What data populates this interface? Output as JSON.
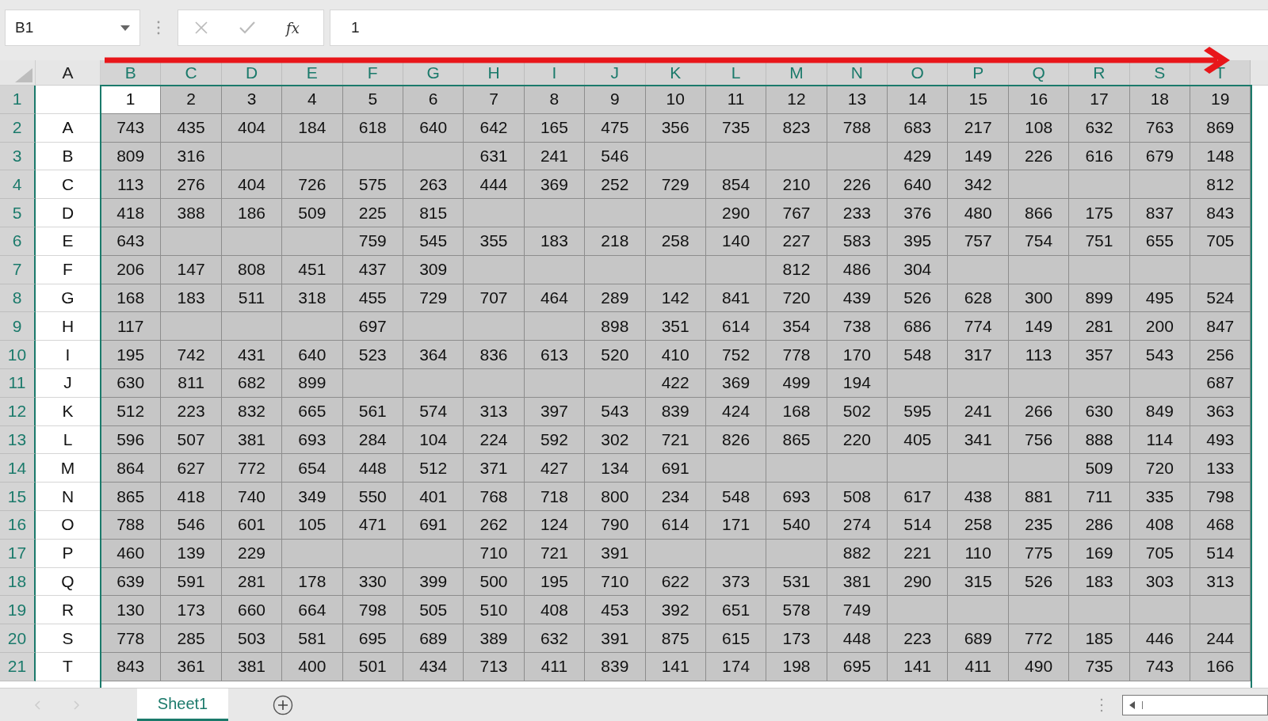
{
  "name_box": {
    "value": "B1"
  },
  "formula_bar": {
    "function_label": "fx",
    "value": "1"
  },
  "columns": [
    {
      "label": "A",
      "selected": false
    },
    {
      "label": "B",
      "selected": true
    },
    {
      "label": "C",
      "selected": true
    },
    {
      "label": "D",
      "selected": true
    },
    {
      "label": "E",
      "selected": true
    },
    {
      "label": "F",
      "selected": true
    },
    {
      "label": "G",
      "selected": true
    },
    {
      "label": "H",
      "selected": true
    },
    {
      "label": "I",
      "selected": true
    },
    {
      "label": "J",
      "selected": true
    },
    {
      "label": "K",
      "selected": true
    },
    {
      "label": "L",
      "selected": true
    },
    {
      "label": "M",
      "selected": true
    },
    {
      "label": "N",
      "selected": true
    },
    {
      "label": "O",
      "selected": true
    },
    {
      "label": "P",
      "selected": true
    },
    {
      "label": "Q",
      "selected": true
    },
    {
      "label": "R",
      "selected": true
    },
    {
      "label": "S",
      "selected": true
    },
    {
      "label": "T",
      "selected": true
    }
  ],
  "rows": [
    {
      "header": "1",
      "selected": true,
      "cells": [
        null,
        {
          "value": "1",
          "active": true
        },
        "2",
        "3",
        "4",
        "5",
        "6",
        "7",
        "8",
        "9",
        "10",
        "11",
        "12",
        "13",
        "14",
        "15",
        "16",
        "17",
        "18",
        "19"
      ]
    },
    {
      "header": "2",
      "selected": true,
      "cells": [
        "A",
        "743",
        "435",
        "404",
        "184",
        "618",
        "640",
        "642",
        "165",
        "475",
        "356",
        "735",
        "823",
        "788",
        "683",
        "217",
        "108",
        "632",
        "763",
        "869"
      ]
    },
    {
      "header": "3",
      "selected": true,
      "cells": [
        "B",
        "809",
        "316",
        null,
        null,
        null,
        null,
        "631",
        "241",
        "546",
        null,
        null,
        null,
        null,
        "429",
        "149",
        "226",
        "616",
        "679",
        "148"
      ]
    },
    {
      "header": "4",
      "selected": true,
      "cells": [
        "C",
        "113",
        "276",
        "404",
        "726",
        "575",
        "263",
        "444",
        "369",
        "252",
        "729",
        "854",
        "210",
        "226",
        "640",
        "342",
        null,
        null,
        null,
        "812"
      ]
    },
    {
      "header": "5",
      "selected": true,
      "cells": [
        "D",
        "418",
        "388",
        "186",
        "509",
        "225",
        "815",
        null,
        null,
        null,
        null,
        "290",
        "767",
        "233",
        "376",
        "480",
        "866",
        "175",
        "837",
        "843"
      ]
    },
    {
      "header": "6",
      "selected": true,
      "cells": [
        "E",
        "643",
        null,
        null,
        null,
        "759",
        "545",
        "355",
        "183",
        "218",
        "258",
        "140",
        "227",
        "583",
        "395",
        "757",
        "754",
        "751",
        "655",
        "705"
      ]
    },
    {
      "header": "7",
      "selected": true,
      "cells": [
        "F",
        "206",
        "147",
        "808",
        "451",
        "437",
        "309",
        null,
        null,
        null,
        null,
        null,
        "812",
        "486",
        "304",
        null,
        null,
        null,
        null,
        null
      ]
    },
    {
      "header": "8",
      "selected": true,
      "cells": [
        "G",
        "168",
        "183",
        "511",
        "318",
        "455",
        "729",
        "707",
        "464",
        "289",
        "142",
        "841",
        "720",
        "439",
        "526",
        "628",
        "300",
        "899",
        "495",
        "524"
      ]
    },
    {
      "header": "9",
      "selected": true,
      "cells": [
        "H",
        "117",
        null,
        null,
        null,
        "697",
        null,
        null,
        null,
        "898",
        "351",
        "614",
        "354",
        "738",
        "686",
        "774",
        "149",
        "281",
        "200",
        "847"
      ]
    },
    {
      "header": "10",
      "selected": true,
      "cells": [
        "I",
        "195",
        "742",
        "431",
        "640",
        "523",
        "364",
        "836",
        "613",
        "520",
        "410",
        "752",
        "778",
        "170",
        "548",
        "317",
        "113",
        "357",
        "543",
        "256"
      ]
    },
    {
      "header": "11",
      "selected": true,
      "cells": [
        "J",
        "630",
        "811",
        "682",
        "899",
        null,
        null,
        null,
        null,
        null,
        "422",
        "369",
        "499",
        "194",
        null,
        null,
        null,
        null,
        null,
        "687"
      ]
    },
    {
      "header": "12",
      "selected": true,
      "cells": [
        "K",
        "512",
        "223",
        "832",
        "665",
        "561",
        "574",
        "313",
        "397",
        "543",
        "839",
        "424",
        "168",
        "502",
        "595",
        "241",
        "266",
        "630",
        "849",
        "363"
      ]
    },
    {
      "header": "13",
      "selected": true,
      "cells": [
        "L",
        "596",
        "507",
        "381",
        "693",
        "284",
        "104",
        "224",
        "592",
        "302",
        "721",
        "826",
        "865",
        "220",
        "405",
        "341",
        "756",
        "888",
        "114",
        "493"
      ]
    },
    {
      "header": "14",
      "selected": true,
      "cells": [
        "M",
        "864",
        "627",
        "772",
        "654",
        "448",
        "512",
        "371",
        "427",
        "134",
        "691",
        null,
        null,
        null,
        null,
        null,
        null,
        "509",
        "720",
        "133"
      ]
    },
    {
      "header": "15",
      "selected": true,
      "cells": [
        "N",
        "865",
        "418",
        "740",
        "349",
        "550",
        "401",
        "768",
        "718",
        "800",
        "234",
        "548",
        "693",
        "508",
        "617",
        "438",
        "881",
        "711",
        "335",
        "798"
      ]
    },
    {
      "header": "16",
      "selected": true,
      "cells": [
        "O",
        "788",
        "546",
        "601",
        "105",
        "471",
        "691",
        "262",
        "124",
        "790",
        "614",
        "171",
        "540",
        "274",
        "514",
        "258",
        "235",
        "286",
        "408",
        "468"
      ]
    },
    {
      "header": "17",
      "selected": true,
      "cells": [
        "P",
        "460",
        "139",
        "229",
        null,
        null,
        null,
        "710",
        "721",
        "391",
        null,
        null,
        null,
        "882",
        "221",
        "110",
        "775",
        "169",
        "705",
        "514"
      ]
    },
    {
      "header": "18",
      "selected": true,
      "cells": [
        "Q",
        "639",
        "591",
        "281",
        "178",
        "330",
        "399",
        "500",
        "195",
        "710",
        "622",
        "373",
        "531",
        "381",
        "290",
        "315",
        "526",
        "183",
        "303",
        "313"
      ]
    },
    {
      "header": "19",
      "selected": true,
      "cells": [
        "R",
        "130",
        "173",
        "660",
        "664",
        "798",
        "505",
        "510",
        "408",
        "453",
        "392",
        "651",
        "578",
        "749",
        null,
        null,
        null,
        null,
        null,
        null
      ]
    },
    {
      "header": "20",
      "selected": true,
      "cells": [
        "S",
        "778",
        "285",
        "503",
        "581",
        "695",
        "689",
        "389",
        "632",
        "391",
        "875",
        "615",
        "173",
        "448",
        "223",
        "689",
        "772",
        "185",
        "446",
        "244"
      ]
    },
    {
      "header": "21",
      "selected": true,
      "cells": [
        "T",
        "843",
        "361",
        "381",
        "400",
        "501",
        "434",
        "713",
        "411",
        "839",
        "141",
        "174",
        "198",
        "695",
        "141",
        "411",
        "490",
        "735",
        "743",
        "166"
      ]
    }
  ],
  "sheet_tabs": [
    {
      "label": "Sheet1",
      "selected": true
    }
  ]
}
